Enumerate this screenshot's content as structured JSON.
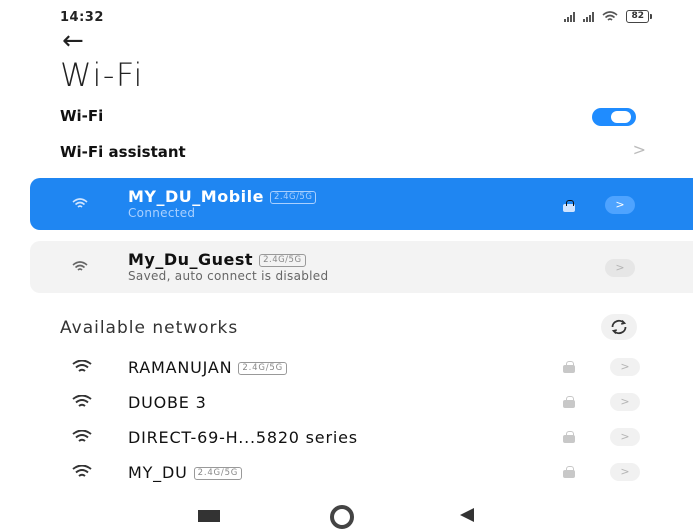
{
  "status_bar": {
    "time": "14:32",
    "battery": "82"
  },
  "header": {
    "back_icon": "arrow-left-icon",
    "title": "Wi-Fi"
  },
  "wifi_toggle": {
    "label": "Wi-Fi",
    "enabled": true
  },
  "wifi_assistant": {
    "label": "Wi-Fi assistant",
    "chevron": ">"
  },
  "saved_networks": [
    {
      "name": "MY_DU_Mobile",
      "band": "2.4G/5G",
      "status": "Connected",
      "locked": true,
      "connected": true
    },
    {
      "name": "My_Du_Guest",
      "band": "2.4G/5G",
      "status": "Saved, auto connect is disabled",
      "locked": false,
      "connected": false
    }
  ],
  "available": {
    "title": "Available networks",
    "refresh_icon": "refresh-icon",
    "items": [
      {
        "name": "RAMANUJAN",
        "band": "2.4G/5G",
        "locked": true
      },
      {
        "name": "DUOBE 3",
        "band": "",
        "locked": true
      },
      {
        "name": "DIRECT-69-H...5820 series",
        "band": "",
        "locked": true
      },
      {
        "name": "MY_DU",
        "band": "2.4G/5G",
        "locked": true
      }
    ]
  },
  "go_glyph": ">",
  "colors": {
    "accent": "#1f86f2",
    "toggle_on": "#1f8cff",
    "card_bg": "#f3f3f3"
  },
  "nav": {
    "recent_icon": "recent-apps-icon",
    "home_icon": "home-icon",
    "back_icon": "nav-back-icon"
  }
}
